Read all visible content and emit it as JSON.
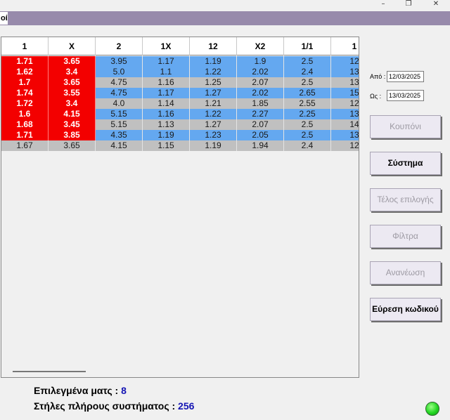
{
  "window": {
    "controls": [
      "–",
      "❐",
      "✕"
    ],
    "menu_tab": "οί"
  },
  "grid": {
    "columns": [
      "1",
      "X",
      "2",
      "1X",
      "12",
      "X2",
      "1/1",
      "1"
    ],
    "rows": [
      {
        "style": "blue",
        "cells": [
          "1.71",
          "3.65",
          "3.95",
          "1.17",
          "1.19",
          "1.9",
          "2.5",
          "12"
        ]
      },
      {
        "style": "blue",
        "cells": [
          "1.62",
          "3.4",
          "5.0",
          "1.1",
          "1.22",
          "2.02",
          "2.4",
          "13"
        ]
      },
      {
        "style": "gray",
        "cells": [
          "1.7",
          "3.65",
          "4.75",
          "1.16",
          "1.25",
          "2.07",
          "2.5",
          "13"
        ]
      },
      {
        "style": "blue",
        "cells": [
          "1.74",
          "3.55",
          "4.75",
          "1.17",
          "1.27",
          "2.02",
          "2.65",
          "15"
        ]
      },
      {
        "style": "gray",
        "cells": [
          "1.72",
          "3.4",
          "4.0",
          "1.14",
          "1.21",
          "1.85",
          "2.55",
          "12"
        ]
      },
      {
        "style": "blue",
        "cells": [
          "1.6",
          "4.15",
          "5.15",
          "1.16",
          "1.22",
          "2.27",
          "2.25",
          "13"
        ]
      },
      {
        "style": "gray",
        "cells": [
          "1.68",
          "3.45",
          "5.15",
          "1.13",
          "1.27",
          "2.07",
          "2.5",
          "14"
        ]
      },
      {
        "style": "blue",
        "cells": [
          "1.71",
          "3.85",
          "4.35",
          "1.19",
          "1.23",
          "2.05",
          "2.5",
          "13"
        ]
      },
      {
        "style": "gray",
        "cells": [
          "1.67",
          "3.65",
          "4.15",
          "1.15",
          "1.19",
          "1.94",
          "2.4",
          "12"
        ]
      }
    ],
    "selected_rows": 8,
    "selected_cols": 2
  },
  "dates": {
    "from_label": "Από :",
    "from_value": "12/03/2025",
    "to_label": "Ως :",
    "to_value": "13/03/2025"
  },
  "buttons": [
    {
      "label": "Κουπόνι",
      "enabled": false,
      "name": "coupon-button"
    },
    {
      "label": "Σύστημα",
      "enabled": true,
      "name": "system-button"
    },
    {
      "label": "Τέλος επιλογής",
      "enabled": false,
      "name": "end-selection-button"
    },
    {
      "label": "Φίλτρα",
      "enabled": false,
      "name": "filters-button"
    },
    {
      "label": "Ανανέωση",
      "enabled": false,
      "name": "refresh-button"
    },
    {
      "label": "Εύρεση κωδικού",
      "enabled": true,
      "name": "find-code-button"
    }
  ],
  "summary": {
    "selected_matches_label": "Επιλεγμένα ματς :",
    "selected_matches_value": "8",
    "full_system_rows_label": "Στήλες πλήρους συστήματος :",
    "full_system_rows_value": "256"
  },
  "colors": {
    "selected_cell": "#f30000",
    "row_blue": "#64a8f0",
    "row_gray": "#c0c0c0",
    "menubar": "#978aab",
    "summary_value": "#1414b4",
    "status_ok": "#22d622"
  },
  "status_icon": "green-status-light-icon"
}
